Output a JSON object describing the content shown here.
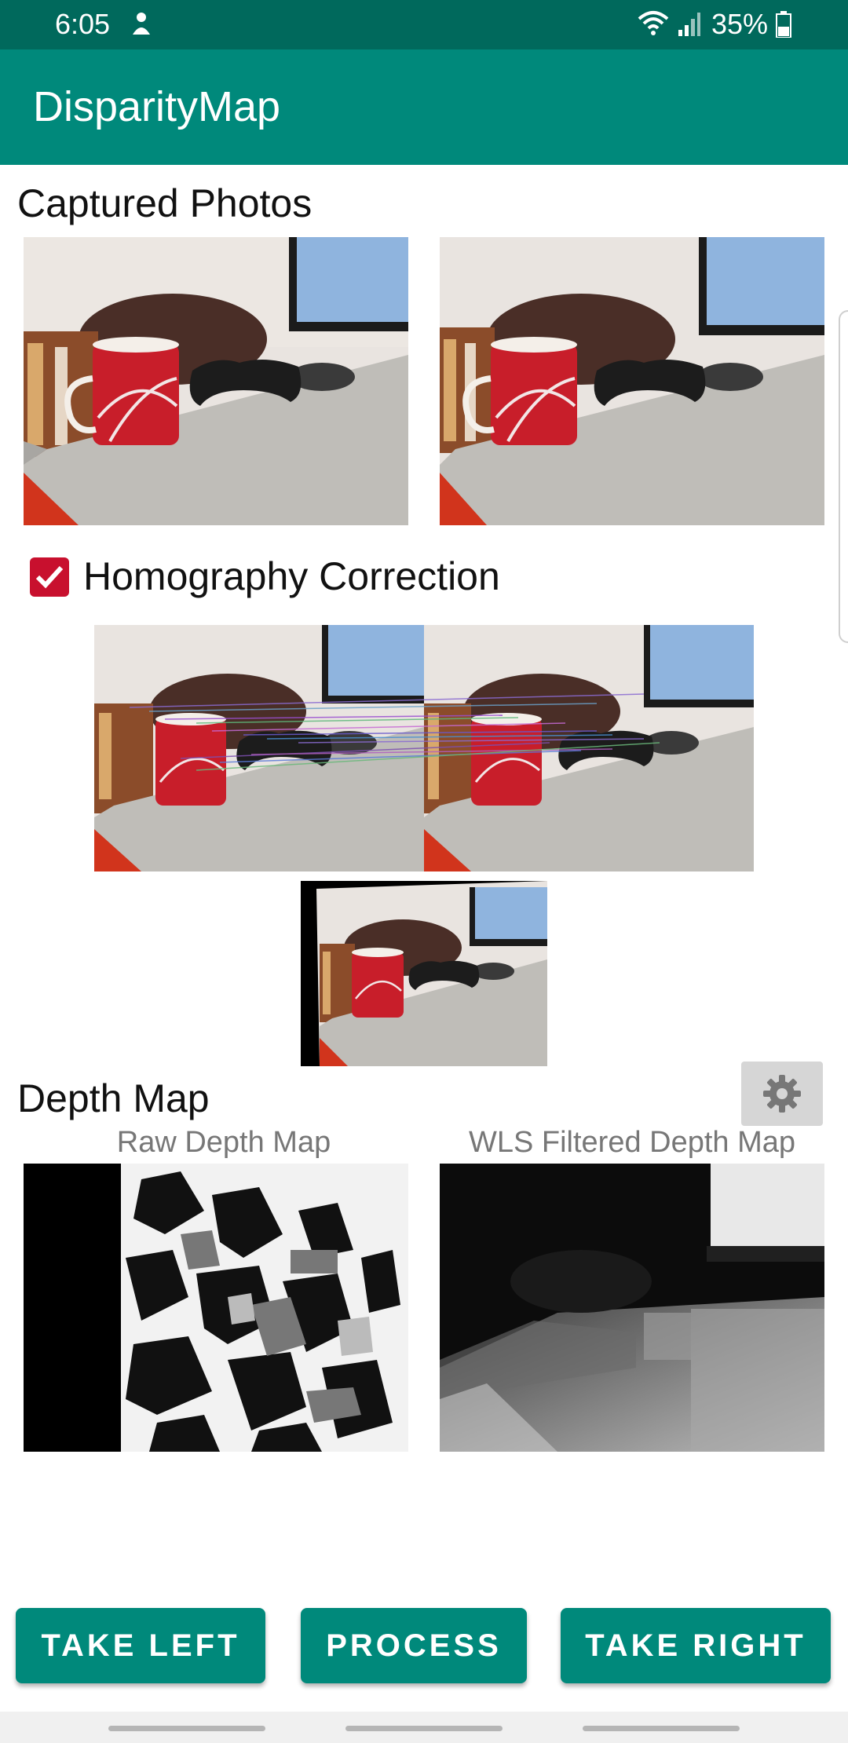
{
  "status_bar": {
    "time": "6:05",
    "battery": "35%",
    "icons": [
      "notification-icon",
      "wifi-icon",
      "signal-icon",
      "battery-icon"
    ]
  },
  "app_bar": {
    "title": "DisparityMap"
  },
  "captured_photos": {
    "title": "Captured Photos"
  },
  "homography": {
    "label": "Homography Correction",
    "checked": true
  },
  "depth_map": {
    "title": "Depth Map",
    "raw_caption": "Raw Depth Map",
    "wls_caption": "WLS Filtered Depth Map"
  },
  "buttons": {
    "take_left": "TAKE LEFT",
    "process": "PROCESS",
    "take_right": "TAKE RIGHT"
  },
  "colors": {
    "status_bar": "#00695c",
    "app_bar": "#00897b",
    "checkbox": "#c8102e",
    "button": "#00897b"
  }
}
